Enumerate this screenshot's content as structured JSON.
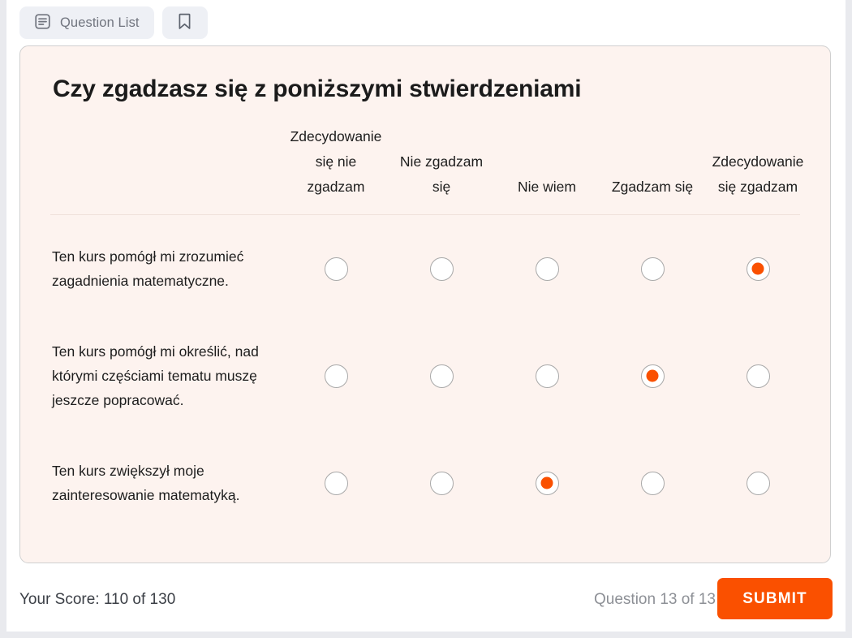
{
  "toolbar": {
    "question_list_label": "Question List",
    "question_list_icon": "document-list-icon",
    "bookmark_icon": "bookmark-icon"
  },
  "card": {
    "title": "Czy zgadzasz się z poniższymi stwierdzeniami",
    "background_color": "#fdf3ef",
    "accent_color": "#fa5000",
    "columns": [
      {
        "label": "Zdecydowanie się nie zgadzam"
      },
      {
        "label": "Nie zgadzam się"
      },
      {
        "label": "Nie wiem"
      },
      {
        "label": "Zgadzam się"
      },
      {
        "label": "Zdecydowanie się zgadzam"
      }
    ],
    "rows": [
      {
        "statement": "Ten kurs pomógł mi zrozumieć zagadnienia matematyczne.",
        "selected": 4
      },
      {
        "statement": "Ten kurs pomógł mi określić, nad którymi częściami tematu muszę jeszcze popracować.",
        "selected": 3
      },
      {
        "statement": "Ten kurs zwiększył moje zainteresowanie matematyką.",
        "selected": 2
      }
    ]
  },
  "footer": {
    "score_label": "Your Score: 110 of 130",
    "question_counter": "Question 13 of 13",
    "submit_label": "SUBMIT"
  }
}
